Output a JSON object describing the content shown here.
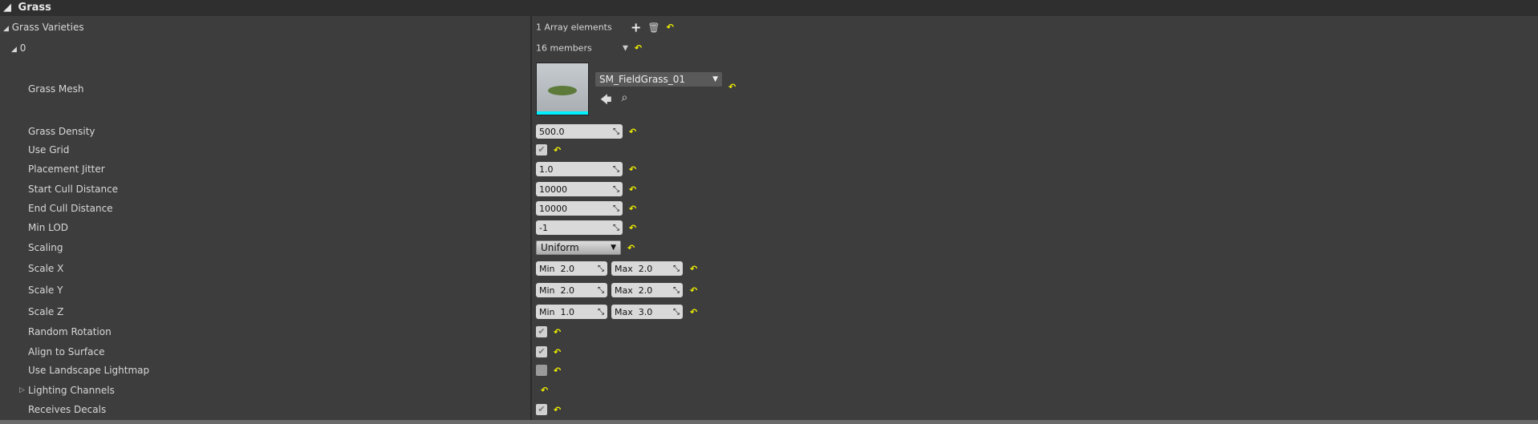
{
  "section": {
    "title": "Grass"
  },
  "array": {
    "label": "Grass Varieties",
    "count_text": "1 Array elements"
  },
  "element": {
    "label": "0",
    "members": "16 members"
  },
  "mesh": {
    "label": "Grass Mesh",
    "asset": "SM_FieldGrass_01"
  },
  "rows": {
    "density": {
      "label": "Grass Density",
      "value": "500.0"
    },
    "use_grid": {
      "label": "Use Grid",
      "checked": true
    },
    "jitter": {
      "label": "Placement Jitter",
      "value": "1.0"
    },
    "start_cull": {
      "label": "Start Cull Distance",
      "value": "10000"
    },
    "end_cull": {
      "label": "End Cull Distance",
      "value": "10000"
    },
    "min_lod": {
      "label": "Min LOD",
      "value": "-1"
    },
    "scaling": {
      "label": "Scaling",
      "value": "Uniform"
    },
    "scale_x": {
      "label": "Scale X",
      "min": "2.0",
      "max": "2.0"
    },
    "scale_y": {
      "label": "Scale Y",
      "min": "2.0",
      "max": "2.0"
    },
    "scale_z": {
      "label": "Scale Z",
      "min": "1.0",
      "max": "3.0"
    },
    "random_rotation": {
      "label": "Random Rotation",
      "checked": true
    },
    "align_surface": {
      "label": "Align to Surface",
      "checked": true
    },
    "landscape_lightmap": {
      "label": "Use Landscape Lightmap",
      "checked": false
    },
    "lighting_channels": {
      "label": "Lighting Channels"
    },
    "receives_decals": {
      "label": "Receives Decals",
      "checked": true
    }
  },
  "common": {
    "min": "Min",
    "max": "Max",
    "reset": "↶"
  }
}
